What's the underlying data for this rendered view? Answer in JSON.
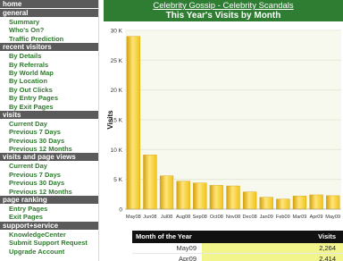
{
  "sidebar": {
    "sections": [
      {
        "title": "home",
        "items": []
      },
      {
        "title": "general",
        "items": [
          "Summary",
          "Who's On?",
          "Traffic Prediction"
        ]
      },
      {
        "title": "recent visitors",
        "items": [
          "By Details",
          "By Referrals",
          "By World Map",
          "By Location",
          "By Out Clicks",
          "By Entry Pages",
          "By Exit Pages"
        ]
      },
      {
        "title": "visits",
        "items": [
          "Current Day",
          "Previous 7 Days",
          "Previous 30 Days",
          "Previous 12 Months"
        ]
      },
      {
        "title": "visits and page views",
        "items": [
          "Current Day",
          "Previous 7 Days",
          "Previous 30 Days",
          "Previous 12 Months"
        ]
      },
      {
        "title": "page ranking",
        "items": [
          "Entry Pages",
          "Exit Pages"
        ]
      },
      {
        "title": "support+service",
        "items": [
          "KnowledgeCenter",
          "Submit Support Request",
          "Upgrade Account"
        ]
      }
    ]
  },
  "header": {
    "site_link": "Celebrity Gossip - Celebrity Scandals",
    "title": "This Year's Visits by Month"
  },
  "chart_data": {
    "type": "bar",
    "title": "",
    "xlabel": "",
    "ylabel": "Visits",
    "categories": [
      "May08",
      "Jun08",
      "Jul08",
      "Aug08",
      "Sep08",
      "Oct08",
      "Nov08",
      "Dec08",
      "Jan09",
      "Feb09",
      "Mar09",
      "Apr09",
      "May09"
    ],
    "values": [
      29000,
      9100,
      5600,
      4700,
      4400,
      4000,
      3900,
      2900,
      2000,
      1700,
      2200,
      2400,
      2264
    ],
    "ylim": [
      0,
      30000
    ],
    "yticks": [
      0,
      5000,
      10000,
      15000,
      20000,
      25000,
      30000
    ],
    "ytick_labels": [
      "0",
      "5 K",
      "10 K",
      "15 K",
      "20 K",
      "25 K",
      "30 K"
    ],
    "grid": true,
    "colors": {
      "bar": "#f0c419",
      "bar_light": "#ffe57a",
      "bar_dark": "#d4a00a",
      "plot_bg": "#f7f8ee",
      "grid": "#ffffff"
    }
  },
  "table": {
    "headers": [
      "Month of the Year",
      "Visits"
    ],
    "rows": [
      {
        "month": "May09",
        "visits": "2,264"
      },
      {
        "month": "Apr09",
        "visits": "2,414"
      }
    ]
  },
  "colors": {
    "header_green": "#2e7d32",
    "nav_green": "#2f7a2f",
    "section_gray": "#5a5a5a"
  }
}
